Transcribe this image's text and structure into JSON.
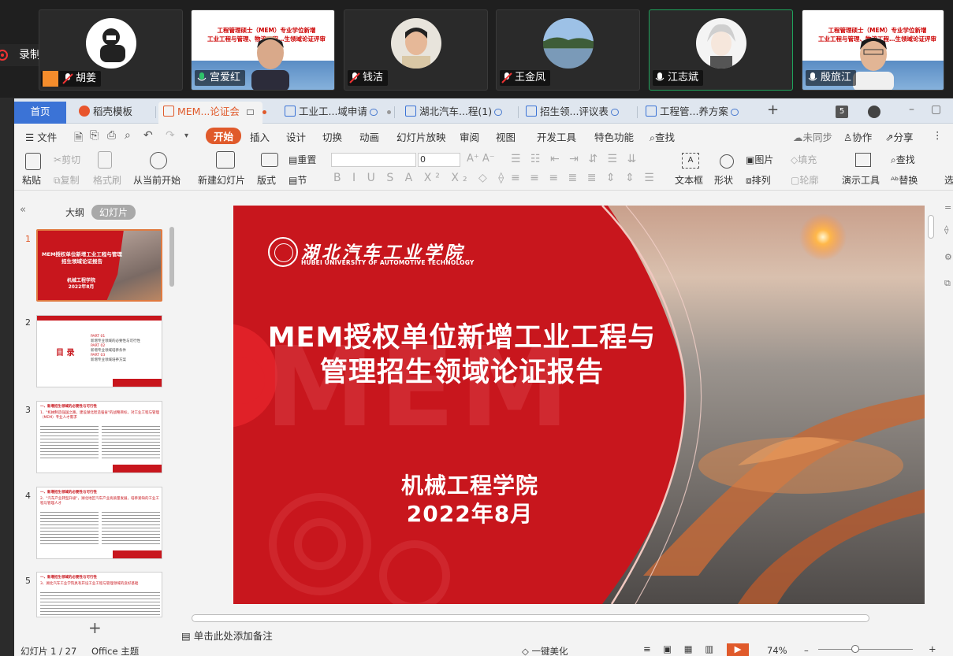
{
  "meeting": {
    "recording_label": "录制中",
    "participants": [
      {
        "name": "胡姜",
        "mic": "muted"
      },
      {
        "name": "宫爱红",
        "mic": "on"
      },
      {
        "name": "钱洁",
        "mic": "muted"
      },
      {
        "name": "王金凤",
        "mic": "muted"
      },
      {
        "name": "江志斌",
        "mic": "on"
      },
      {
        "name": "殷旅江",
        "mic": "on"
      }
    ],
    "shared_screen_text_line1": "工程管理硕士（MEM）专业学位新增",
    "shared_screen_text_line2": "工业工程与管理、物流工程…生领域论证评审会"
  },
  "wps": {
    "tabs": [
      {
        "label": "首页"
      },
      {
        "label": "稻壳模板"
      },
      {
        "label": "MEM...论证会"
      },
      {
        "label": "工业工...域申请"
      },
      {
        "label": "湖北汽车...程(1)"
      },
      {
        "label": "招生领...评议表"
      },
      {
        "label": "工程管...养方案"
      }
    ],
    "tab_count": "5",
    "menu": {
      "file": "文件",
      "items": [
        "开始",
        "插入",
        "设计",
        "切换",
        "动画",
        "幻灯片放映",
        "审阅",
        "视图",
        "开发工具",
        "特色功能"
      ],
      "search": "查找",
      "unsynced": "未同步",
      "collaborate": "协作",
      "share": "分享"
    },
    "ribbon": {
      "paste": "粘贴",
      "cut": "剪切",
      "copy": "复制",
      "format_painter": "格式刷",
      "from_current": "从当前开始",
      "new_slide": "新建幻灯片",
      "layout": "版式",
      "reset": "重置",
      "section": "节",
      "font_size": "0",
      "textbox": "文本框",
      "shape": "形状",
      "picture": "图片",
      "fill": "填充",
      "arrange": "排列",
      "outline": "轮廓",
      "presenter_tools": "演示工具",
      "find": "查找",
      "replace": "替换",
      "select": "选"
    },
    "left_panel": {
      "outline_tab": "大纲",
      "slides_tab": "幻灯片",
      "thumbs": [
        {
          "num": "1",
          "title": "MEM授权单位新增工业工程与管理招生领域论证报告",
          "sub1": "机械工程学院",
          "sub2": "2022年8月"
        },
        {
          "num": "2",
          "title": "目 录",
          "p1": "PART 01",
          "l1": "新增专业领域的必要性与可行性",
          "p2": "PART 02",
          "l2": "新增专业领域培养条件",
          "p3": "PART 03",
          "l3": "新增专业领域培养方案"
        },
        {
          "num": "3",
          "head": "一、新增招生领域的必要性与可行性",
          "line": "1、\"机械制造强国之路，建设湖北智造强省\"的战略目标，对工业工程与管理（MEM）专业人才需求"
        },
        {
          "num": "4",
          "head": "一、新增招生领域的必要性与可行性",
          "line": "2、\"汽车产业转型升级\"，湖北地区汽车产业高质量发展，培养紧缺的工业工程与管理人才"
        },
        {
          "num": "5",
          "head": "一、新增招生领域的必要性与可行性",
          "line": "3、湖北汽车工业学院具有开设工业工程与管理领域的良好基础"
        }
      ]
    },
    "slide": {
      "school_cn": "湖北汽车工业学院",
      "school_en": "HUBEI UNIVERSITY OF AUTOMOTIVE TECHNOLOGY",
      "watermark": "MEM",
      "title_line1": "MEM授权单位新增工业工程与",
      "title_line2": "管理招生领域论证报告",
      "college": "机械工程学院",
      "date": "2022年8月"
    },
    "notes_placeholder": "单击此处添加备注",
    "status": {
      "slide_pos": "幻灯片 1 / 27",
      "theme": "Office 主题",
      "beautify": "一键美化",
      "zoom": "74%"
    },
    "colors": {
      "accent": "#e05a2b",
      "slide_red": "#c8161d",
      "home_tab": "#3b73d6"
    }
  }
}
